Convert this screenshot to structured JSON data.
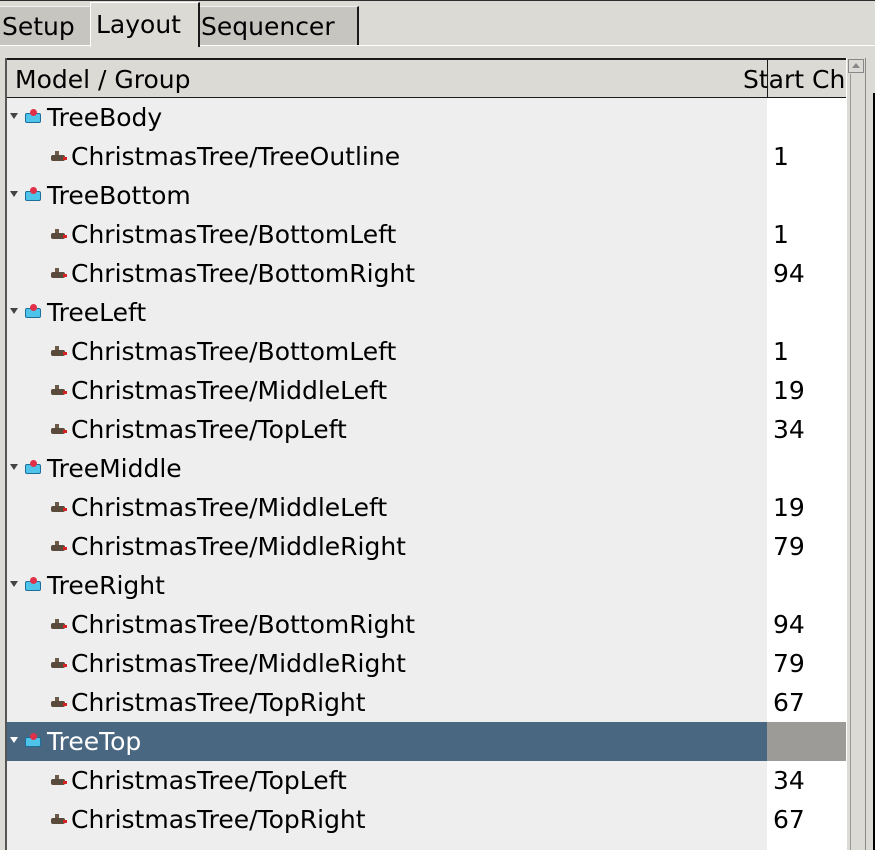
{
  "tabs": [
    {
      "label": "Setup",
      "active": false
    },
    {
      "label": "Layout",
      "active": true
    },
    {
      "label": "Sequencer",
      "active": false
    }
  ],
  "columns": {
    "model_group": "Model / Group",
    "start_ch": "Start Ch"
  },
  "groups": [
    {
      "name": "TreeBody",
      "selected": false,
      "models": [
        {
          "name": "ChristmasTree/TreeOutline",
          "start": "1"
        }
      ]
    },
    {
      "name": "TreeBottom",
      "selected": false,
      "models": [
        {
          "name": "ChristmasTree/BottomLeft",
          "start": "1"
        },
        {
          "name": "ChristmasTree/BottomRight",
          "start": "94"
        }
      ]
    },
    {
      "name": "TreeLeft",
      "selected": false,
      "models": [
        {
          "name": "ChristmasTree/BottomLeft",
          "start": "1"
        },
        {
          "name": "ChristmasTree/MiddleLeft",
          "start": "19"
        },
        {
          "name": "ChristmasTree/TopLeft",
          "start": "34"
        }
      ]
    },
    {
      "name": "TreeMiddle",
      "selected": false,
      "models": [
        {
          "name": "ChristmasTree/MiddleLeft",
          "start": "19"
        },
        {
          "name": "ChristmasTree/MiddleRight",
          "start": "79"
        }
      ]
    },
    {
      "name": "TreeRight",
      "selected": false,
      "models": [
        {
          "name": "ChristmasTree/BottomRight",
          "start": "94"
        },
        {
          "name": "ChristmasTree/MiddleRight",
          "start": "79"
        },
        {
          "name": "ChristmasTree/TopRight",
          "start": "67"
        }
      ]
    },
    {
      "name": "TreeTop",
      "selected": true,
      "models": [
        {
          "name": "ChristmasTree/TopLeft",
          "start": "34"
        },
        {
          "name": "ChristmasTree/TopRight",
          "start": "67"
        }
      ]
    }
  ],
  "icons": {
    "group": "model-group-icon",
    "model": "model-icon",
    "expander": "expand-triangle-icon"
  },
  "colors": {
    "selection": "#4a6782",
    "selection_secondary": "#9c9b97"
  }
}
